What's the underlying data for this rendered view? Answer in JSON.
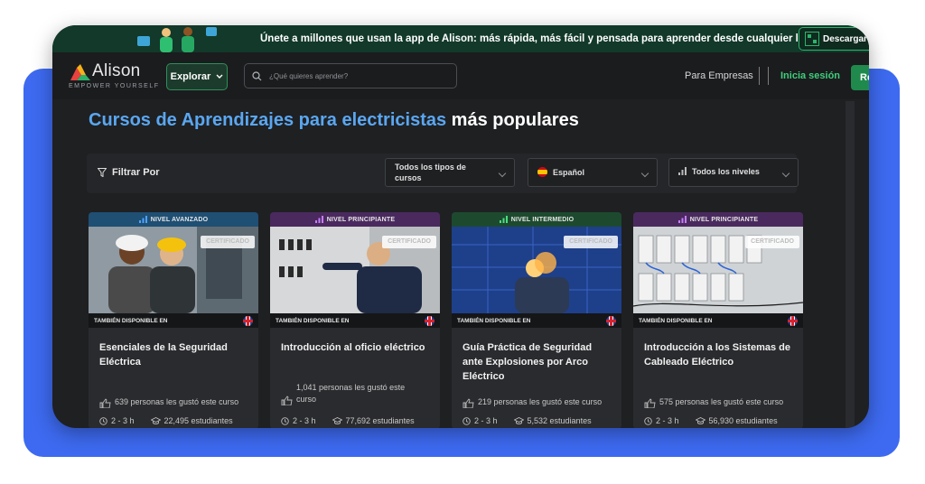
{
  "banner": {
    "text": "Únete a millones que usan la app de Alison: más rápida, más fácil y pensada para aprender desde cualquier lugar",
    "download_label": "Descargar"
  },
  "nav": {
    "logo_name": "Alison",
    "logo_tagline": "EMPOWER YOURSELF",
    "explore_label": "Explorar",
    "search_placeholder": "¿Qué quieres aprender?",
    "business_label": "Para Empresas",
    "login_label": "Inicia sesión",
    "register_label": "Re"
  },
  "heading": {
    "blue_part": "Cursos de Aprendizajes para electricistas",
    "white_part": "más populares"
  },
  "filters": {
    "label": "Filtrar Por",
    "course_type": "Todos los tipos de cursos",
    "language": "Español",
    "level": "Todos los niveles"
  },
  "certificate_label": "CERTIFICADO",
  "available_label": "TAMBIÉN DISPONIBLE EN",
  "courses": [
    {
      "level": "NIVEL AVANZADO",
      "level_color": "#1f4f73",
      "title": "Esenciales de la Seguridad Eléctrica",
      "likes": "639 personas les gustó este curso",
      "duration": "2 - 3 h",
      "students": "22,495 estudiantes"
    },
    {
      "level": "NIVEL PRINCIPIANTE",
      "level_color": "#4a2a5e",
      "title": "Introducción al oficio eléctrico",
      "likes": "1,041 personas les gustó este curso",
      "duration": "2 - 3 h",
      "students": "77,692 estudiantes"
    },
    {
      "level": "NIVEL INTERMEDIO",
      "level_color": "#1d4a2f",
      "title": "Guía Práctica de Seguridad ante Explosiones por Arco Eléctrico",
      "likes": "219 personas les gustó este curso",
      "duration": "2 - 3 h",
      "students": "5,532 estudiantes"
    },
    {
      "level": "NIVEL PRINCIPIANTE",
      "level_color": "#4a2a5e",
      "title": "Introducción a los Sistemas de Cableado Eléctrico",
      "likes": "575 personas les gustó este curso",
      "duration": "2 - 3 h",
      "students": "56,930 estudiantes"
    }
  ],
  "colors": {
    "accent_green": "#3fcf7b",
    "heading_blue": "#5aa7f2",
    "frame_blue": "#3d6af0"
  }
}
